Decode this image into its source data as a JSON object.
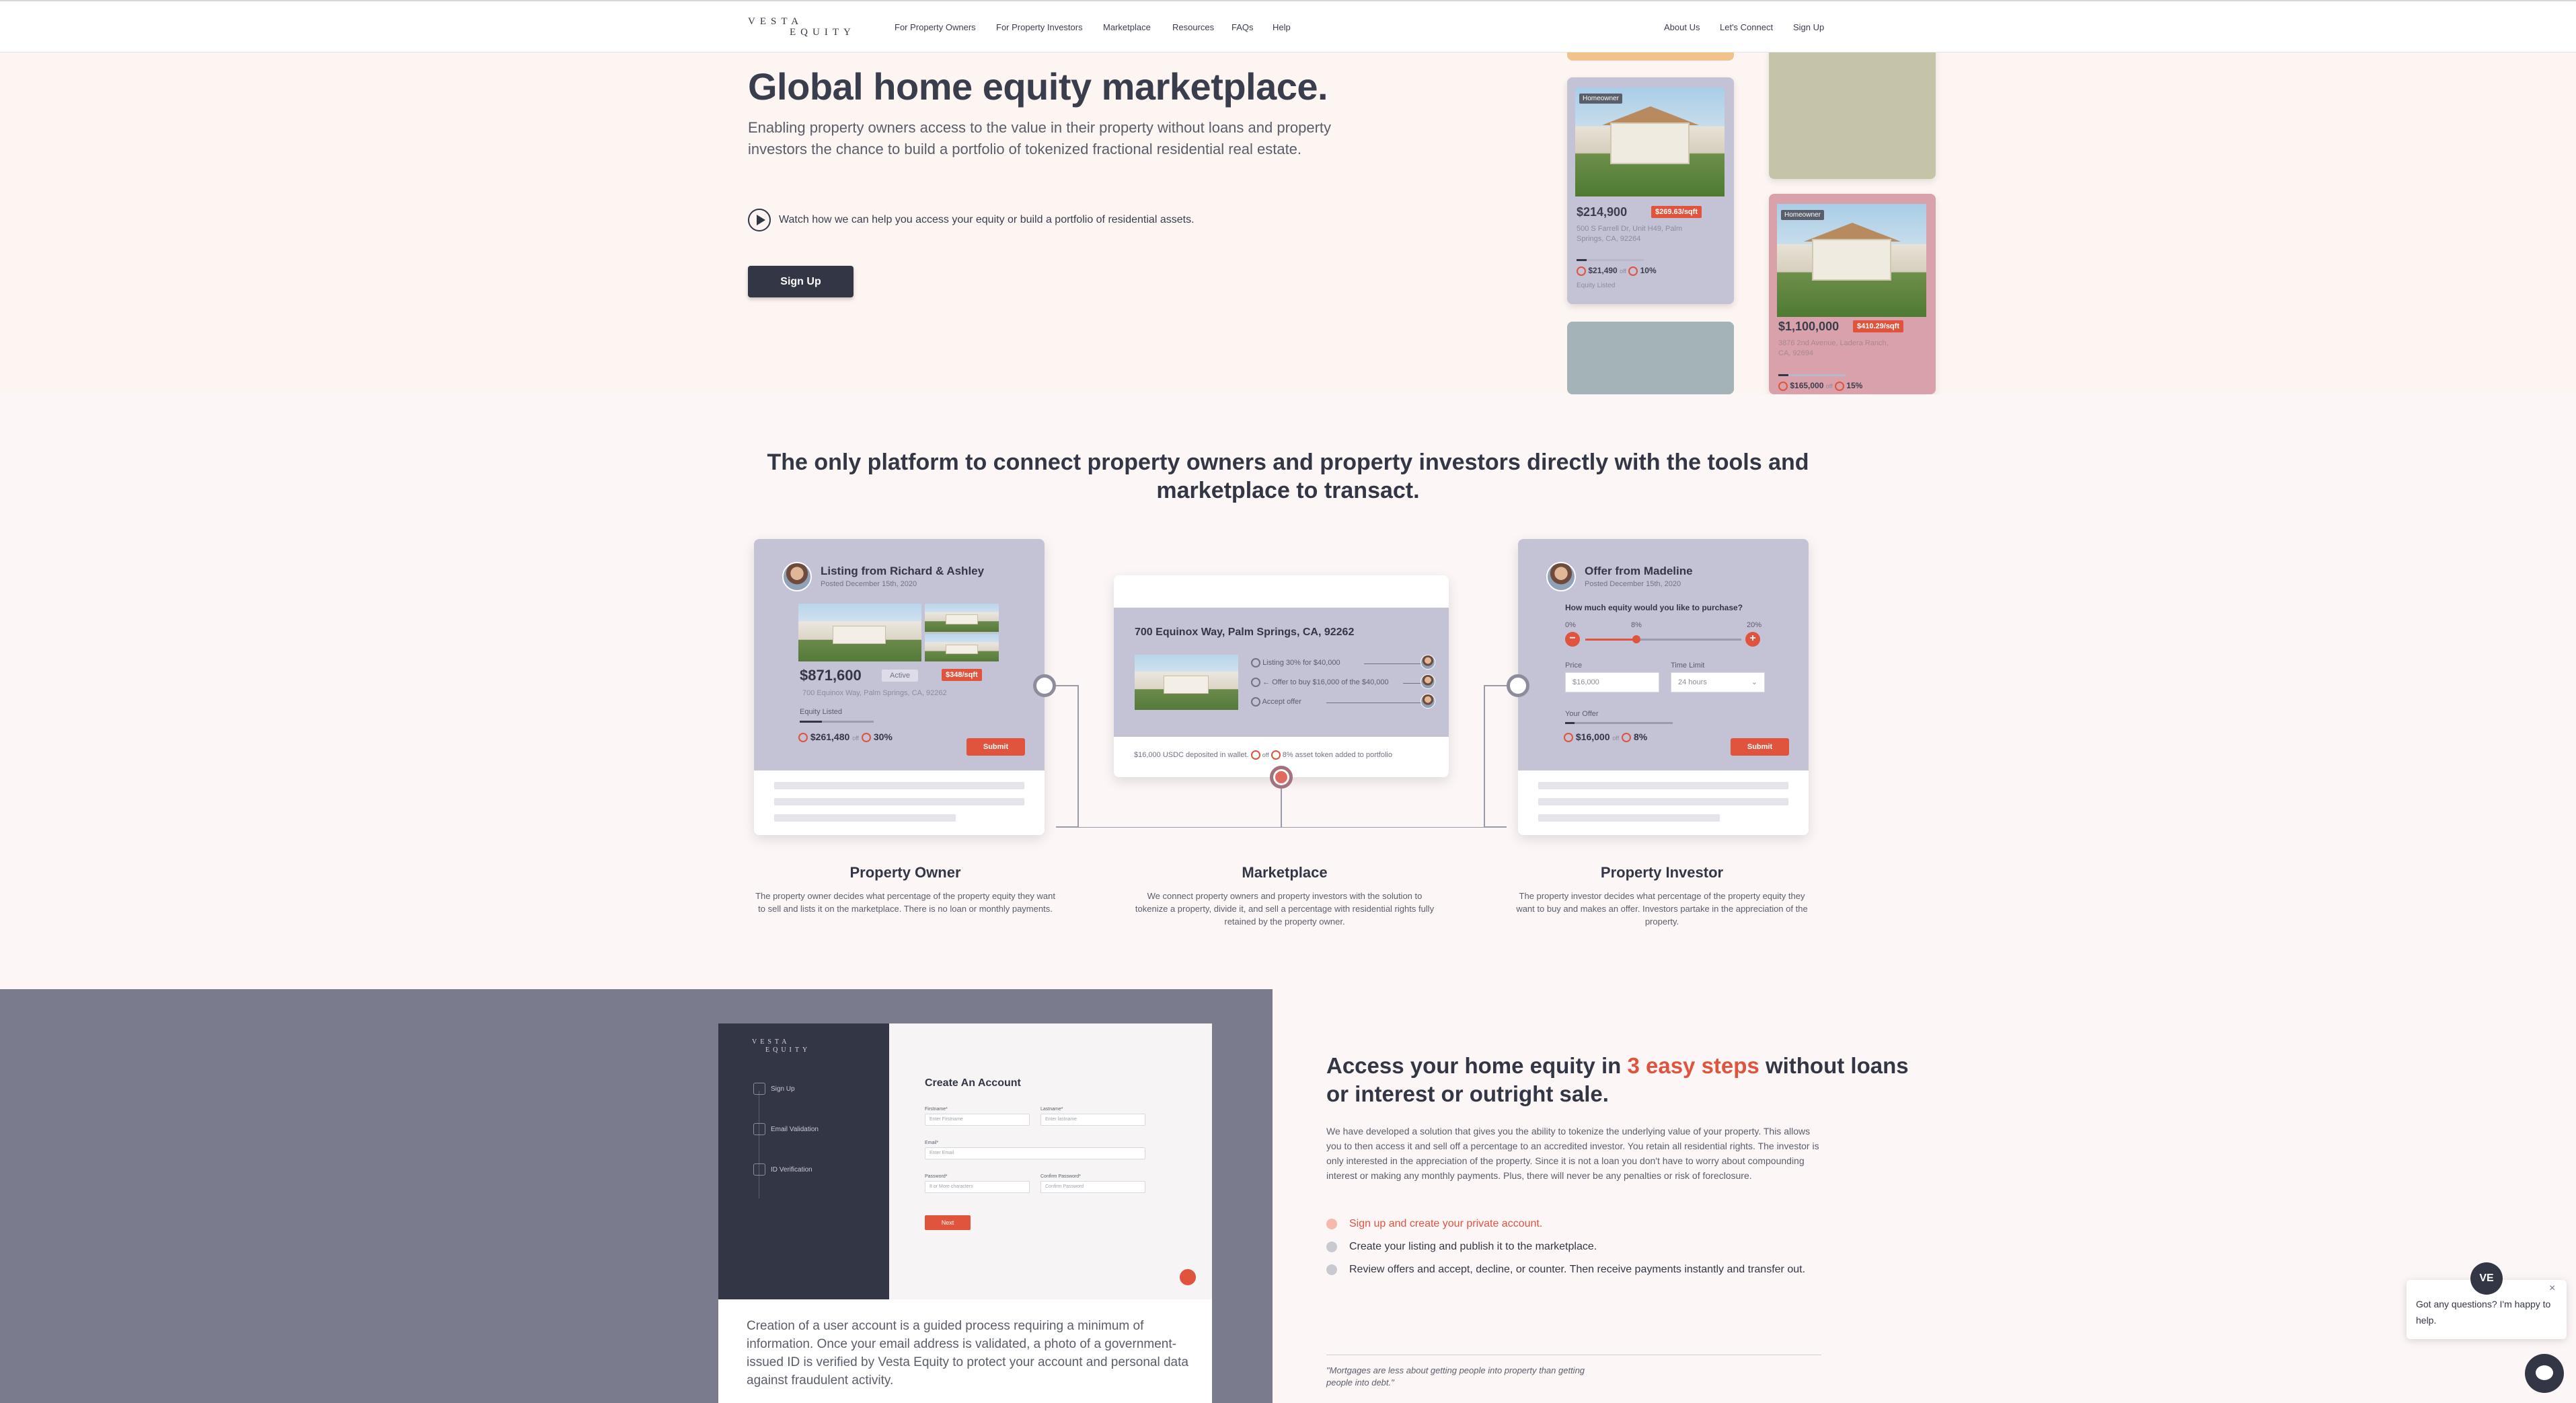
{
  "nav": {
    "logo_line1": "VESTA",
    "logo_line2": "EQUITY",
    "links": [
      "For Property Owners",
      "For Property Investors",
      "Marketplace",
      "Resources",
      "FAQs",
      "Help"
    ],
    "right_links": [
      "About Us",
      "Let's Connect",
      "Sign Up"
    ]
  },
  "hero": {
    "title": "Global home equity marketplace.",
    "subtitle": "Enabling property owners access to the value in their property without loans and property investors the chance to build a portfolio of tokenized fractional residential real estate.",
    "watch_text": "Watch how we can help you access your equity or build a portfolio of residential assets.",
    "signup_label": "Sign Up",
    "cards": [
      {
        "tag": "Homeowner",
        "price": "$214,900",
        "price_per_sqft": "$269.63/sqft",
        "address": "500 S Farrell Dr, Unit H49, Palm Springs, CA, 92264",
        "equity_amount": "$21,490",
        "equity_pct": "10%",
        "equity_label": "Equity Listed",
        "off": "off"
      },
      {
        "tag": "Homeowner",
        "price": "$1,100,000",
        "price_per_sqft": "$410.29/sqft",
        "address": "3876 2nd Avenue, Ladera Ranch, CA, 92694",
        "equity_amount": "$165,000",
        "equity_pct": "15%",
        "off": "off"
      }
    ]
  },
  "platform": {
    "title": "The only platform to connect property owners and property investors directly with the tools and marketplace to transact.",
    "listing_card": {
      "title": "Listing from Richard & Ashley",
      "posted": "Posted December 15th, 2020",
      "price": "$871,600",
      "status": "Active",
      "price_per_sqft": "$348/sqft",
      "address": "700 Equinox Way, Palm Springs, CA, 92262",
      "equity_label": "Equity Listed",
      "equity_amount": "$261,480",
      "off": "off",
      "equity_pct": "30%",
      "submit": "Submit"
    },
    "market_card": {
      "address": "700 Equinox Way, Palm Springs, CA, 92262",
      "rows": [
        "Listing 30% for $40,000",
        "← Offer to buy $16,000 of the $40,000",
        "Accept offer"
      ],
      "footer_left": "$16,000 USDC deposited in wallet.",
      "off": "off",
      "footer_right": "8% asset token added to portfolio"
    },
    "offer_card": {
      "title": "Offer from Madeline",
      "posted": "Posted December 15th, 2020",
      "question": "How much equity would you like to purchase?",
      "slider_min": "0%",
      "slider_val": "8%",
      "slider_max": "20%",
      "price_label": "Price",
      "price_value": "$16,000",
      "timelimit_label": "Time Limit",
      "timelimit_value": "24 hours",
      "your_offer_label": "Your Offer",
      "offer_amount": "$16,000",
      "off": "off",
      "offer_pct": "8%",
      "submit": "Submit"
    },
    "columns": [
      {
        "heading": "Property Owner",
        "text": "The property owner decides what percentage of the property equity they want to sell and lists it on the marketplace. There is no loan or monthly payments."
      },
      {
        "heading": "Marketplace",
        "text": "We connect property owners and property investors with the solution to tokenize a property, divide it, and sell a percentage with residential rights fully retained by the property owner."
      },
      {
        "heading": "Property Investor",
        "text": "The property investor decides what percentage of the property equity they want to buy and makes an offer. Investors partake in the appreciation of the property."
      }
    ]
  },
  "steps_section": {
    "mock": {
      "logo_line1": "VESTA",
      "logo_line2": "EQUITY",
      "steps": [
        "Sign Up",
        "Email Validation",
        "ID Verification"
      ],
      "form_title": "Create An Account",
      "fields": [
        {
          "label": "Firstname*",
          "placeholder": "Enter Firstname"
        },
        {
          "label": "Lastname*",
          "placeholder": "Enter lastname"
        },
        {
          "label": "Email*",
          "placeholder": "Enter Email"
        },
        {
          "label": "Password*",
          "placeholder": "8 or More characters"
        },
        {
          "label": "Confirm Password*",
          "placeholder": "Confirm Password"
        }
      ],
      "next": "Next"
    },
    "caption": "Creation of a user account is a guided process requiring a minimum of information. Once your email address is validated, a photo of a government-issued ID is verified by Vesta Equity to protect your account and personal data against fraudulent activity.",
    "title_a": "Access your home equity in ",
    "title_highlight": "3 easy steps",
    "title_b": " without loans or interest or outright sale.",
    "body": "We have developed a solution that gives you the ability to tokenize the underlying value of your property. This allows you to then access it and sell off a percentage to an accredited investor. You retain all residential rights. The investor is only interested in the appreciation of the property. Since it is not a loan you don't have to worry about compounding interest or making any monthly payments. Plus, there will never be any penalties or risk of foreclosure.",
    "steps": [
      "Sign up and create your private account.",
      "Create your listing and publish it to the marketplace.",
      "Review offers and accept, decline, or counter. Then receive payments instantly and transfer out."
    ],
    "quote": "\"Mortgages are less about getting people into property than getting people into debt.\""
  },
  "chat": {
    "avatar_text": "VE",
    "message": "Got any questions? I'm happy to help.",
    "close": "×"
  },
  "colors": {
    "primary": "#333645",
    "accent": "#e0533d",
    "hero_bg": "#fdf5f1"
  }
}
